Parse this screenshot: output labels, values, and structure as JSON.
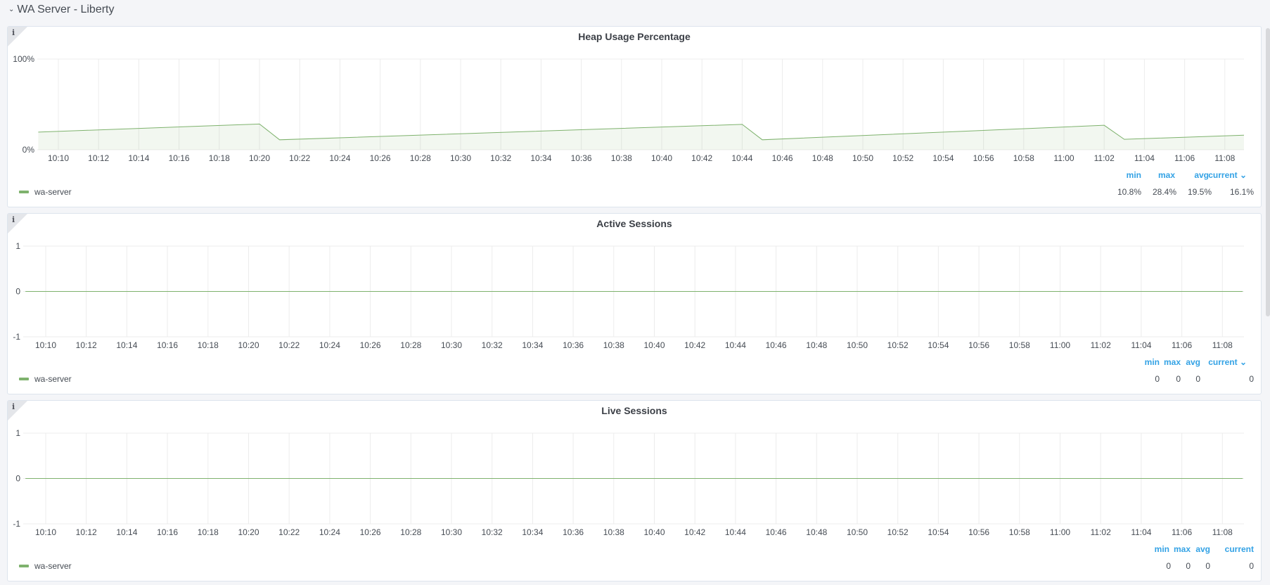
{
  "row": {
    "title": "WA Server - Liberty",
    "chevron": "chevron-down-icon"
  },
  "panels": [
    {
      "id": "heap",
      "title": "Heap Usage Percentage",
      "info_icon": "i",
      "y_ticks": [
        "100%",
        "0%"
      ],
      "x_ticks": [
        "10:10",
        "10:12",
        "10:14",
        "10:16",
        "10:18",
        "10:20",
        "10:22",
        "10:24",
        "10:26",
        "10:28",
        "10:30",
        "10:32",
        "10:34",
        "10:36",
        "10:38",
        "10:40",
        "10:42",
        "10:44",
        "10:46",
        "10:48",
        "10:50",
        "10:52",
        "10:54",
        "10:56",
        "10:58",
        "11:00",
        "11:02",
        "11:04",
        "11:06",
        "11:08"
      ],
      "legend": {
        "series": "wa-server",
        "color": "#7eb26d"
      },
      "stats_labels": {
        "min": "min",
        "max": "max",
        "avg": "avg",
        "current": "current"
      },
      "stats": {
        "min": "10.8%",
        "max": "28.4%",
        "avg": "19.5%",
        "current": "16.1%"
      }
    },
    {
      "id": "active",
      "title": "Active Sessions",
      "info_icon": "i",
      "y_ticks": [
        "1",
        "0",
        "-1"
      ],
      "x_ticks": [
        "10:10",
        "10:12",
        "10:14",
        "10:16",
        "10:18",
        "10:20",
        "10:22",
        "10:24",
        "10:26",
        "10:28",
        "10:30",
        "10:32",
        "10:34",
        "10:36",
        "10:38",
        "10:40",
        "10:42",
        "10:44",
        "10:46",
        "10:48",
        "10:50",
        "10:52",
        "10:54",
        "10:56",
        "10:58",
        "11:00",
        "11:02",
        "11:04",
        "11:06",
        "11:08"
      ],
      "legend": {
        "series": "wa-server",
        "color": "#7eb26d"
      },
      "stats_labels": {
        "min": "min",
        "max": "max",
        "avg": "avg",
        "current": "current"
      },
      "stats": {
        "min": "0",
        "max": "0",
        "avg": "0",
        "current": "0"
      }
    },
    {
      "id": "live",
      "title": "Live Sessions",
      "info_icon": "i",
      "y_ticks": [
        "1",
        "0",
        "-1"
      ],
      "x_ticks": [
        "10:10",
        "10:12",
        "10:14",
        "10:16",
        "10:18",
        "10:20",
        "10:22",
        "10:24",
        "10:26",
        "10:28",
        "10:30",
        "10:32",
        "10:34",
        "10:36",
        "10:38",
        "10:40",
        "10:42",
        "10:44",
        "10:46",
        "10:48",
        "10:50",
        "10:52",
        "10:54",
        "10:56",
        "10:58",
        "11:00",
        "11:02",
        "11:04",
        "11:06",
        "11:08"
      ],
      "legend": {
        "series": "wa-server",
        "color": "#7eb26d"
      },
      "stats_labels": {
        "min": "min",
        "max": "max",
        "avg": "avg",
        "current": "current"
      },
      "stats": {
        "min": "0",
        "max": "0",
        "avg": "0",
        "current": "0"
      }
    }
  ],
  "chart_data": [
    {
      "type": "area",
      "title": "Heap Usage Percentage",
      "xlabel": "",
      "ylabel": "",
      "ylim": [
        0,
        100
      ],
      "grid": true,
      "legend_placement": "bottom-left",
      "series": [
        {
          "name": "wa-server",
          "color": "#7eb26d",
          "points": [
            [
              "10:09",
              19.5
            ],
            [
              "10:20",
              28.4
            ],
            [
              "10:21",
              11.0
            ],
            [
              "10:44",
              28.0
            ],
            [
              "10:45",
              11.0
            ],
            [
              "11:02",
              27.0
            ],
            [
              "11:03",
              11.5
            ],
            [
              "11:09",
              16.1
            ]
          ]
        }
      ]
    },
    {
      "type": "line",
      "title": "Active Sessions",
      "xlabel": "",
      "ylabel": "",
      "ylim": [
        -1,
        1
      ],
      "grid": true,
      "legend_placement": "bottom-left",
      "series": [
        {
          "name": "wa-server",
          "color": "#7eb26d",
          "points": [
            [
              "10:09",
              0
            ],
            [
              "11:09",
              0
            ]
          ]
        }
      ]
    },
    {
      "type": "line",
      "title": "Live Sessions",
      "xlabel": "",
      "ylabel": "",
      "ylim": [
        -1,
        1
      ],
      "grid": true,
      "legend_placement": "bottom-left",
      "series": [
        {
          "name": "wa-server",
          "color": "#7eb26d",
          "points": [
            [
              "10:09",
              0
            ],
            [
              "11:09",
              0
            ]
          ]
        }
      ]
    }
  ]
}
